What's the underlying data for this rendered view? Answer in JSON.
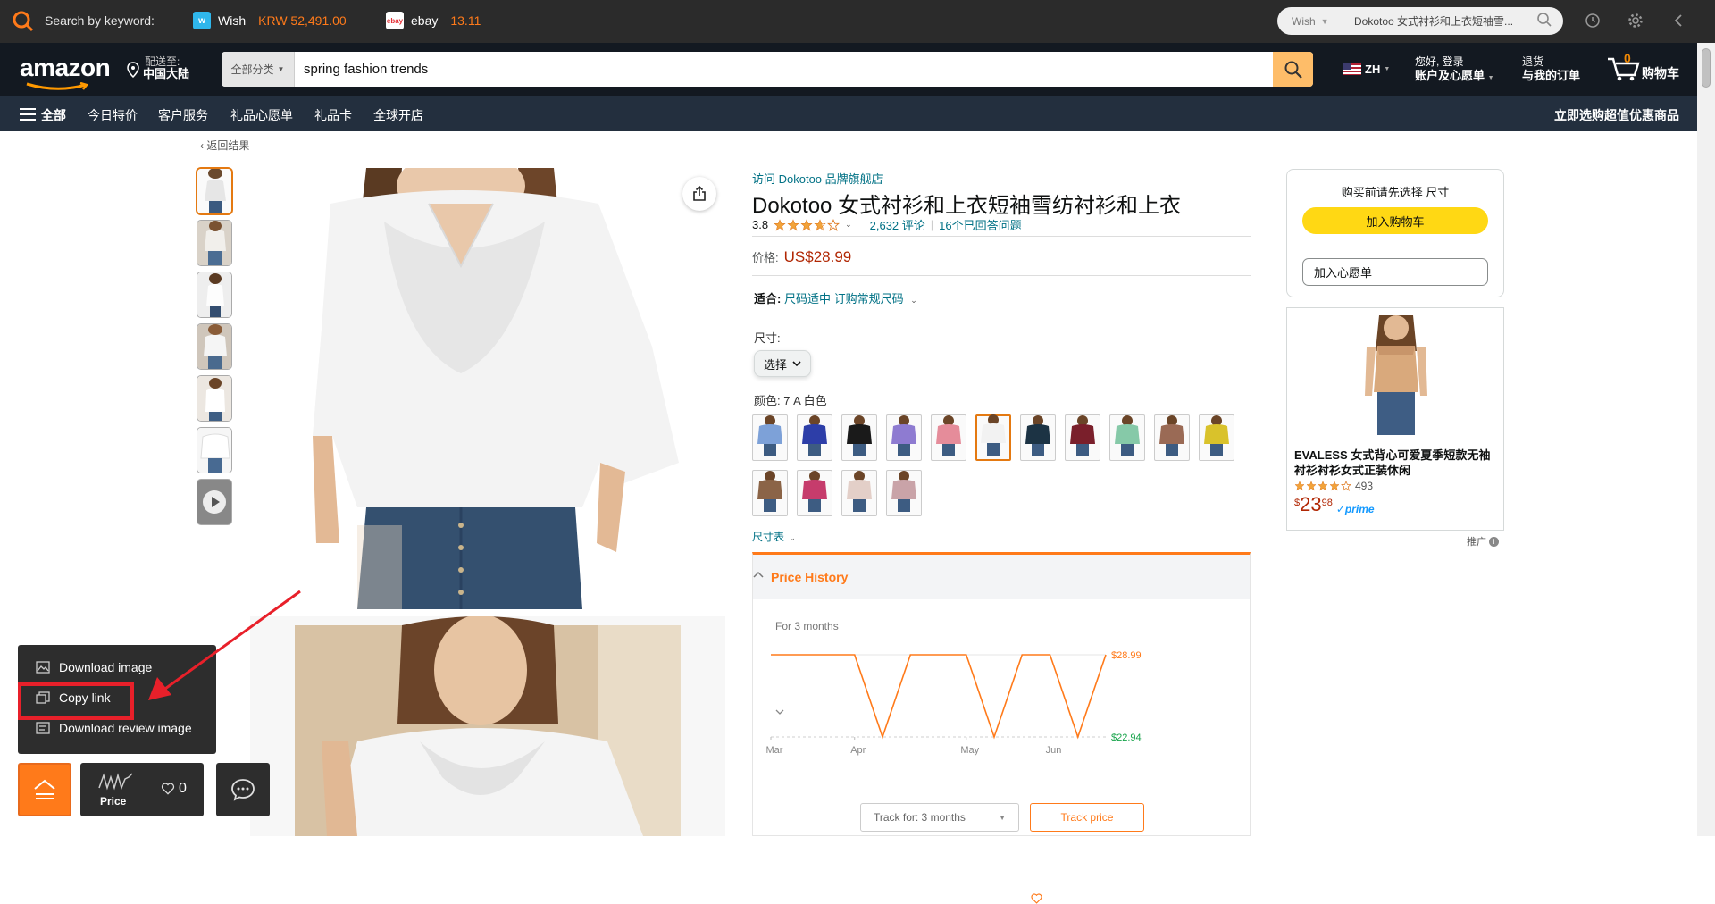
{
  "extension": {
    "keyword_label": "Search by keyword:",
    "sites": [
      {
        "name": "Wish",
        "value": "KRW 52,491.00",
        "logo": "w"
      },
      {
        "name": "ebay",
        "value": "13.11",
        "logo": "ebay"
      }
    ],
    "search_site": "Wish",
    "search_text": "Dokotoo 女式衬衫和上衣短袖雪..."
  },
  "header": {
    "logo": "amazon",
    "deliver_line1": "配送至:",
    "deliver_line2": "中国大陆",
    "search_category": "全部分类",
    "search_query": "spring fashion trends",
    "lang": "ZH",
    "account_line1": "您好, 登录",
    "account_line2": "账户及心愿单",
    "orders_line1": "退货",
    "orders_line2": "与我的订单",
    "cart_count": "0",
    "cart_label": "购物车"
  },
  "subnav": {
    "all": "全部",
    "items": [
      "今日特价",
      "客户服务",
      "礼品心愿单",
      "礼品卡",
      "全球开店"
    ],
    "right": "立即选购超值优惠商品"
  },
  "product": {
    "back": "返回结果",
    "brand_link": "访问 Dokotoo 品牌旗舰店",
    "title": "Dokotoo 女式衬衫和上衣短袖雪纺衬衫和上衣",
    "rating": "3.8",
    "reviews": "2,632 评论",
    "answered": "16个已回答问题",
    "price_label": "价格:",
    "price": "US$28.99",
    "fit_label": "适合:",
    "fit_value": "尺码适中 订购常规尺码",
    "size_label": "尺寸:",
    "size_select": "选择",
    "color_label": "颜色: 7 A 白色",
    "size_chart": "尺寸表",
    "swatch_colors": [
      "#7da1d8",
      "#2d3ea8",
      "#1a1a1a",
      "#8e7bd1",
      "#e58c9a",
      "#f2f2f2",
      "#1c3344",
      "#7a1f2b",
      "#86c9a8",
      "#9a6a55",
      "#d9c22b",
      "#8b6447",
      "#c63c6c",
      "#e3cfc8",
      "#c9a3a8"
    ]
  },
  "price_history": {
    "title": "Price History",
    "range": "For 3 months",
    "high_label": "$28.99",
    "low_label": "$22.94",
    "track_select": "Track for: 3 months",
    "track_button": "Track price"
  },
  "chart_data": {
    "type": "line",
    "x": [
      "Mar",
      "",
      "",
      "Apr",
      "",
      "",
      "",
      "May",
      "",
      "",
      "Jun",
      "",
      ""
    ],
    "x_ticks": [
      "Mar",
      "Apr",
      "May",
      "Jun"
    ],
    "values": [
      28.99,
      28.99,
      28.99,
      28.99,
      22.94,
      28.99,
      28.99,
      28.99,
      22.94,
      28.99,
      28.99,
      22.94,
      28.99
    ],
    "ylim": [
      22.94,
      28.99
    ],
    "colors": {
      "line": "#ff7a1a",
      "high": "#ff7a1a",
      "low": "#16a34a"
    }
  },
  "buybox": {
    "message": "购买前请先选择 尺寸",
    "add_to_cart": "加入购物车",
    "add_to_list": "加入心愿单"
  },
  "ad": {
    "name": "EVALESS 女式背心可爱夏季短款无袖衬衫衬衫女式正装休闲",
    "reviews": "493",
    "price_symbol": "$",
    "price_whole": "23",
    "price_fraction": "98",
    "prime": "prime",
    "tag": "推广"
  },
  "widget": {
    "menu": [
      "Download image",
      "Copy link",
      "Download review image"
    ],
    "price_label": "Price",
    "likes": "0"
  }
}
